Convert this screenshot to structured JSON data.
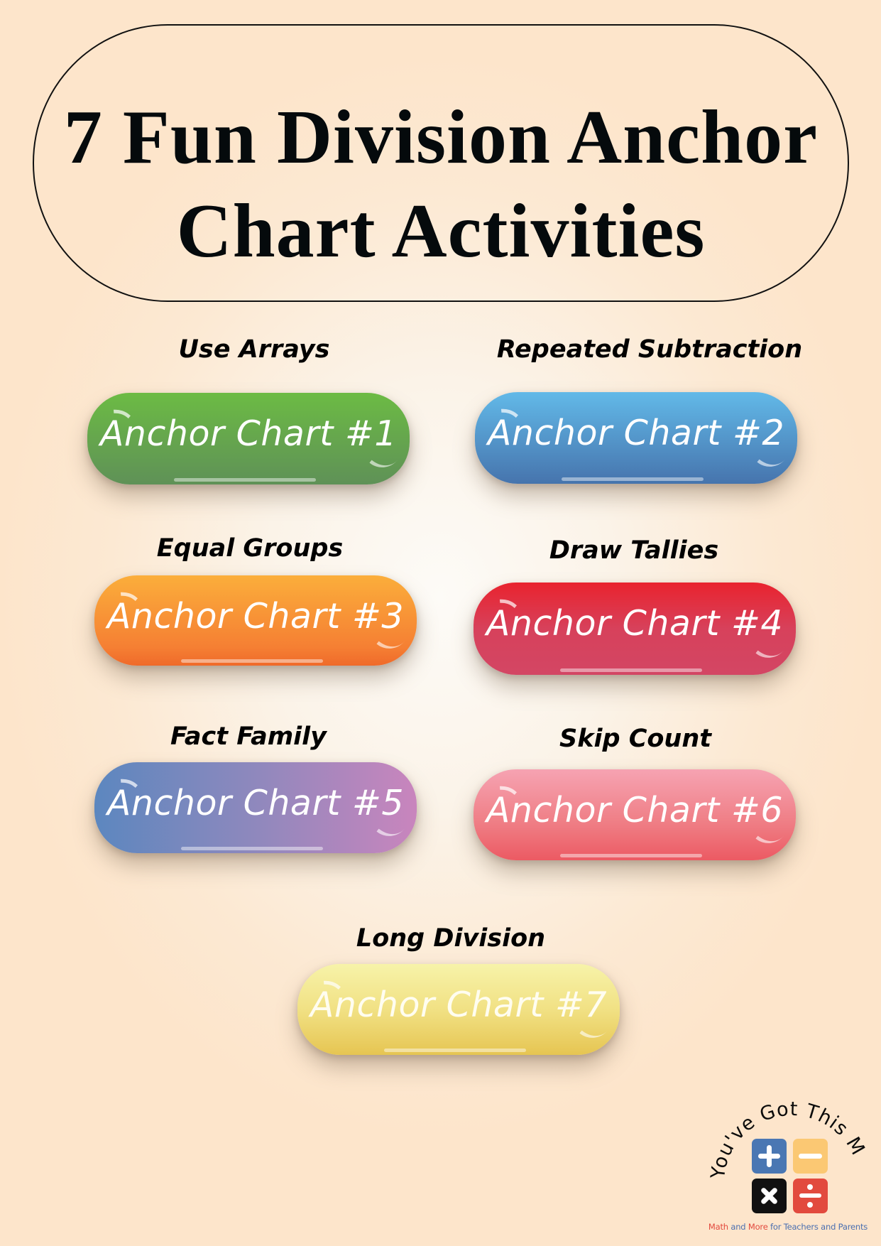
{
  "title": {
    "line1": "7 Fun Division Anchor",
    "line2": "Chart Activities"
  },
  "activities": [
    {
      "label": "Use Arrays",
      "button": "Anchor Chart #1",
      "color": "#6cbb44"
    },
    {
      "label": "Repeated Subtraction",
      "button": "Anchor Chart #2",
      "color": "#4f8cc9"
    },
    {
      "label": "Equal Groups",
      "button": "Anchor Chart #3",
      "color": "#f89837"
    },
    {
      "label": "Draw Tallies",
      "button": "Anchor Chart #4",
      "color": "#dd3147"
    },
    {
      "label": "Fact Family",
      "button": "Anchor Chart #5",
      "color": "#8f88bd"
    },
    {
      "label": "Skip Count",
      "button": "Anchor Chart #6",
      "color": "#f0808a"
    },
    {
      "label": "Long Division",
      "button": "Anchor Chart #7",
      "color": "#f1e184"
    }
  ],
  "logo": {
    "arc_text": "You've Got This Math",
    "icons": [
      "plus-icon",
      "minus-icon",
      "times-icon",
      "divide-icon"
    ],
    "tagline": {
      "w1": "Math",
      "w2": "and",
      "w3": "More",
      "w4": "for Teachers and Parents"
    },
    "colors": {
      "blue": "#4a77b3",
      "yellow": "#fbc873",
      "black": "#111111",
      "red": "#e24a3e"
    }
  }
}
